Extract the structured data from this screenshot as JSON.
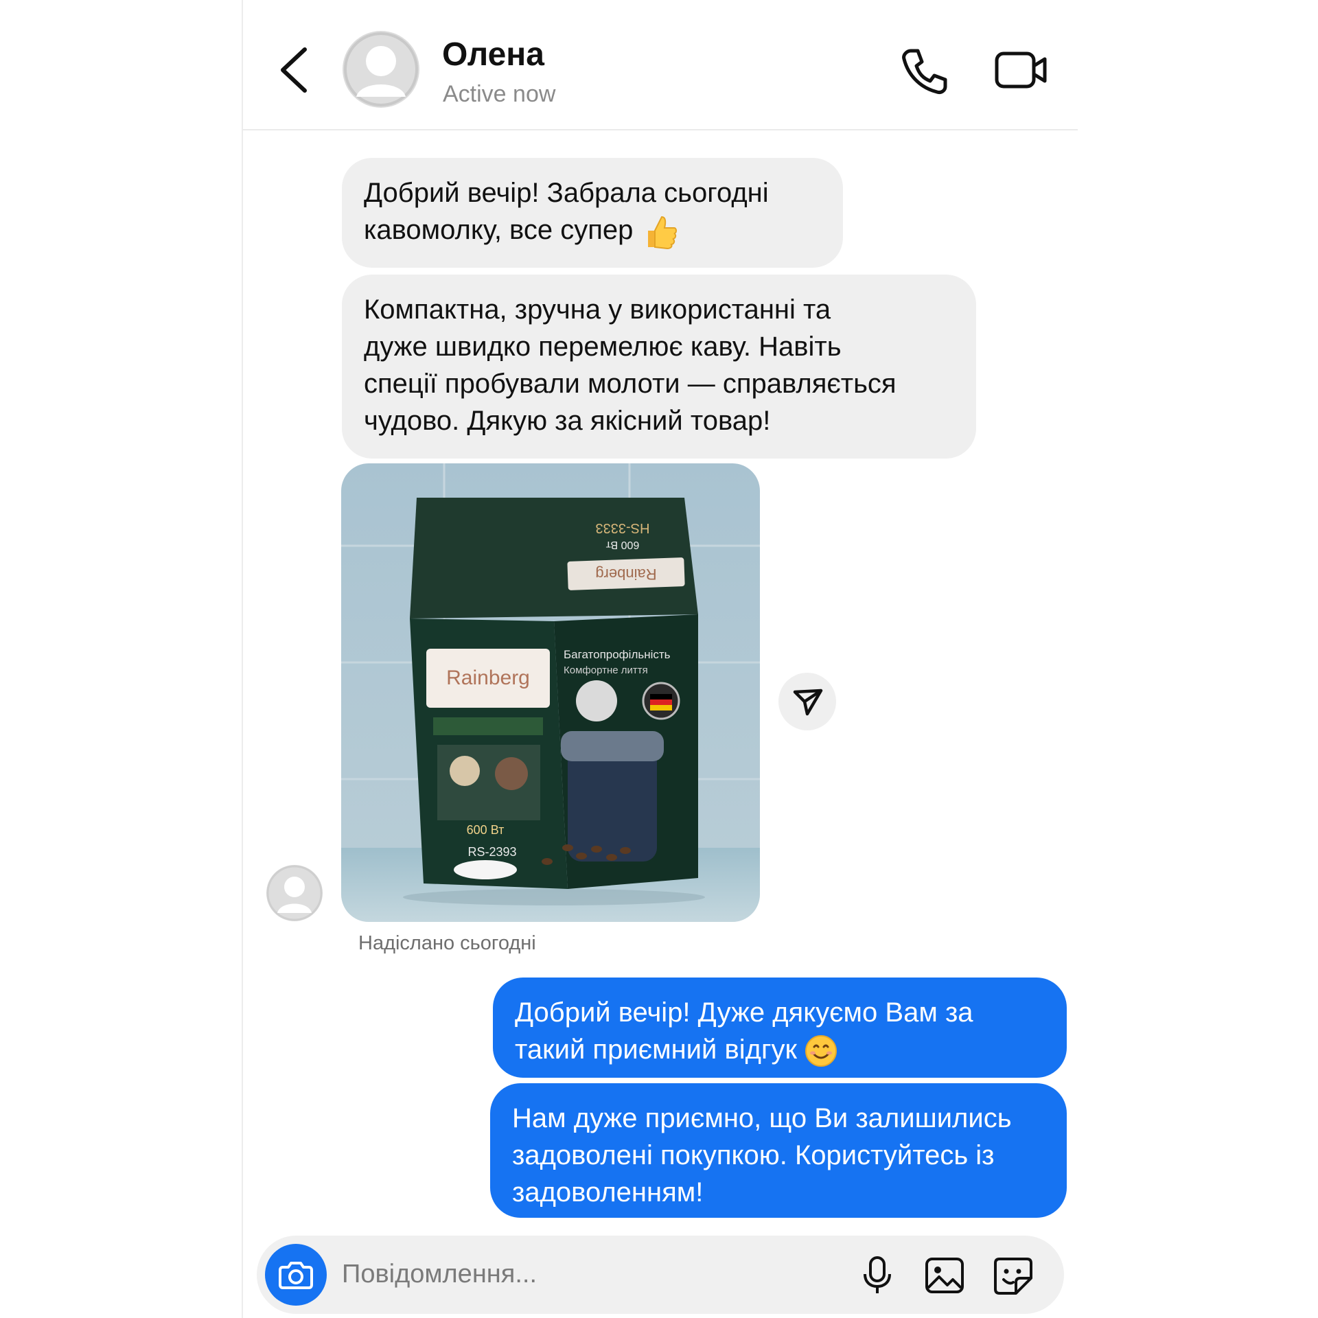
{
  "header": {
    "contact_name": "Олена",
    "status": "Active now"
  },
  "messages": [
    {
      "from": "contact",
      "text": "Добрий вечір! Забрала сьогодні кавомолку, все супер",
      "emoji": "thumbs-up"
    },
    {
      "from": "contact",
      "lines": [
        "Компактна, зручна у використанні та",
        "дуже швидко перемелює каву. Навіть",
        "спеції пробували молоти — справляється",
        "чудово. Дякую за якісний товар!"
      ]
    },
    {
      "from": "contact",
      "type": "photo"
    },
    {
      "from": "me",
      "lines": [
        "Добрий вечір! Дуже дякуємо Вам за",
        "такий приємний відгук"
      ],
      "emoji": "smiling-face"
    },
    {
      "from": "me",
      "lines": [
        "Нам дуже приємно, що Ви залишились",
        "задоволені покупкою. Користуйтесь із",
        "задоволенням!"
      ]
    }
  ],
  "photo_box": {
    "brand": "Rainberg",
    "tagline_1": "Багатопрофільність",
    "tagline_2": "Комфортне лиття",
    "power": "600 Вт",
    "model": "RS-2393",
    "top_model": "HS-3333",
    "top_power": "600 Вт"
  },
  "sent_label": "Надіслано сьогодні",
  "composer": {
    "placeholder": "Повідомлення..."
  },
  "colors": {
    "outgoing_bubble": "#1673f2",
    "incoming_bubble": "#efefef"
  }
}
